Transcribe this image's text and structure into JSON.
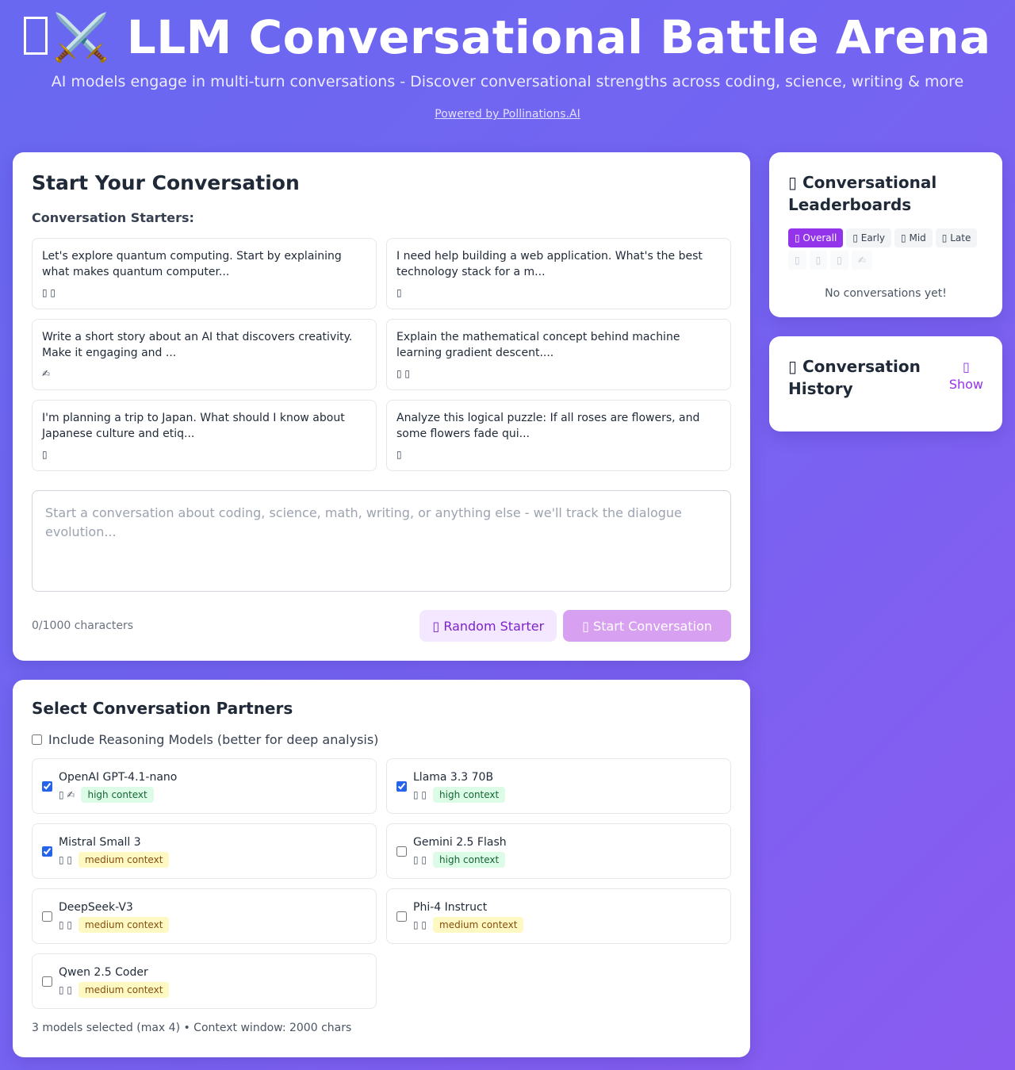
{
  "header": {
    "title_icon": "swords-icon",
    "title": "⚔️ LLM Conversational Battle Arena",
    "subtitle": "AI models engage in multi-turn conversations - Discover conversational strengths across coding, science, writing & more",
    "powered_by": "Powered by Pollinations.AI"
  },
  "starter": {
    "title": "Start Your Conversation",
    "section_label": "Conversation Starters:",
    "items": [
      {
        "text": "Let's explore quantum computing. Start by explaining what makes quantum computer...",
        "icons": "▯ ▯"
      },
      {
        "text": "I need help building a web application. What's the best technology stack for a m...",
        "icons": "▯"
      },
      {
        "text": "Write a short story about an AI that discovers creativity. Make it engaging and ...",
        "icons": "✍"
      },
      {
        "text": "Explain the mathematical concept behind machine learning gradient descent....",
        "icons": "▯ ▯"
      },
      {
        "text": "I'm planning a trip to Japan. What should I know about Japanese culture and etiq...",
        "icons": "▯"
      },
      {
        "text": "Analyze this logical puzzle: If all roses are flowers, and some flowers fade qui...",
        "icons": "▯"
      }
    ],
    "prompt_placeholder": "Start a conversation about coding, science, math, writing, or anything else - we'll track the dialogue evolution...",
    "char_count": "0/1000 characters",
    "random_label": "▯ Random Starter",
    "start_label": "▯ Start Conversation"
  },
  "partners": {
    "title": "Select Conversation Partners",
    "reasoning_label": "Include Reasoning Models (better for deep analysis)",
    "models": [
      {
        "name": "OpenAI GPT-4.1-nano",
        "icons": "▯ ✍",
        "context": "high context",
        "checked": true
      },
      {
        "name": "Llama 3.3 70B",
        "icons": "▯ ▯",
        "context": "high context",
        "checked": true
      },
      {
        "name": "Mistral Small 3",
        "icons": "▯ ▯",
        "context": "medium context",
        "checked": true
      },
      {
        "name": "Gemini 2.5 Flash",
        "icons": "▯ ▯",
        "context": "high context",
        "checked": false
      },
      {
        "name": "DeepSeek-V3",
        "icons": "▯ ▯",
        "context": "medium context",
        "checked": false
      },
      {
        "name": "Phi-4 Instruct",
        "icons": "▯ ▯",
        "context": "medium context",
        "checked": false
      },
      {
        "name": "Qwen 2.5 Coder",
        "icons": "▯ ▯",
        "context": "medium context",
        "checked": false
      }
    ],
    "footer": "3 models selected (max 4) • Context window: 2000 chars"
  },
  "leaderboard": {
    "title": "▯ Conversational Leaderboards",
    "tabs": [
      "▯ Overall",
      "▯ Early",
      "▯ Mid",
      "▯ Late",
      "▯",
      "▯",
      "▯",
      "✍"
    ],
    "empty": "No conversations yet!"
  },
  "history": {
    "title": "▯ Conversation History",
    "show_icon": "▯",
    "show_label": "Show"
  }
}
